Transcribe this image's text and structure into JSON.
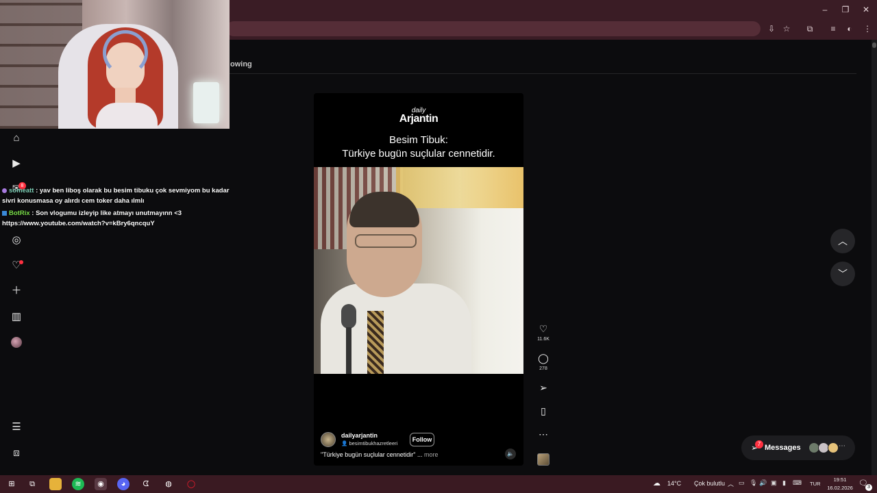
{
  "browser": {
    "window_controls": {
      "minimize": "–",
      "restore": "❐",
      "close": "✕"
    },
    "toolbar_icons": [
      "install-app-icon",
      "star-icon",
      "extensions-icon",
      "media-control-icon",
      "profile-icon",
      "kebab-menu-icon"
    ]
  },
  "page": {
    "tab_label_partial": "owing"
  },
  "sidebar": {
    "notif_badge": "8"
  },
  "chat": [
    {
      "user": "someatt",
      "message": ": yav ben liboş olarak bu besim tibuku çok sevmiyom bu kadar sivri konusmasa oy alırdı cem toker daha ılmlı"
    },
    {
      "user": "BotRix",
      "message": ": Son vlogumu izleyip like atmayı unutmayınn <3 https://www.youtube.com/watch?v=kBry6qncquY"
    }
  ],
  "reel": {
    "logo_top": "daily",
    "logo_main": "Arjantin",
    "headline_line1": "Besim Tibuk:",
    "headline_line2": "Türkiye bugün suçlular cennetidir.",
    "username": "dailyarjantin",
    "collab": "besimtibukhazretleeri",
    "follow_label": "Follow",
    "caption": "\"Türkiye bugün suçlular cennetidir\" ...",
    "more_label": "more",
    "likes": "11.6K",
    "comments": "278"
  },
  "messages": {
    "label": "Messages",
    "count": "7"
  },
  "taskbar": {
    "temp": "14°C",
    "weather_desc": "Çok bulutlu",
    "lang": "TUR",
    "time": "19:51",
    "date": "16.02.2026",
    "notif_count": "3"
  },
  "colors": {
    "accent_red": "#ff3040",
    "titlebar": "#3a1c25",
    "taskbar": "#3a1a22"
  }
}
